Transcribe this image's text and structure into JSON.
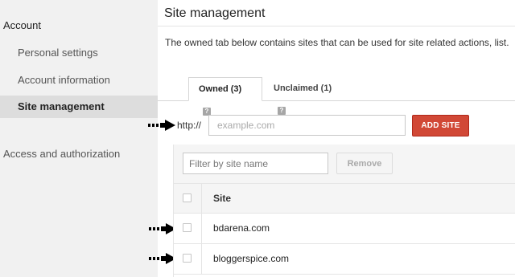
{
  "sidebar": {
    "heading": "Account",
    "items": [
      {
        "label": "Personal settings"
      },
      {
        "label": "Account information"
      },
      {
        "label": "Site management"
      }
    ],
    "section2": "Access and authorization"
  },
  "main": {
    "title": "Site management",
    "description": "The owned tab below contains sites that can be used for site related actions, list.",
    "tabs": [
      {
        "label": "Owned (3)",
        "help": "?"
      },
      {
        "label": "Unclaimed (1)",
        "help": "?"
      }
    ],
    "add_site": {
      "prefix": "http://",
      "placeholder": "example.com",
      "button_label": "ADD SITE"
    },
    "table": {
      "filter_placeholder": "Filter by site name",
      "remove_label": "Remove",
      "column_header": "Site",
      "rows": [
        {
          "site": "bdarena.com"
        },
        {
          "site": "bloggerspice.com"
        }
      ]
    }
  },
  "colors": {
    "accent_button": "#d14836",
    "sidebar_bg": "#f1f1f1",
    "sidebar_active": "#dddddd"
  }
}
